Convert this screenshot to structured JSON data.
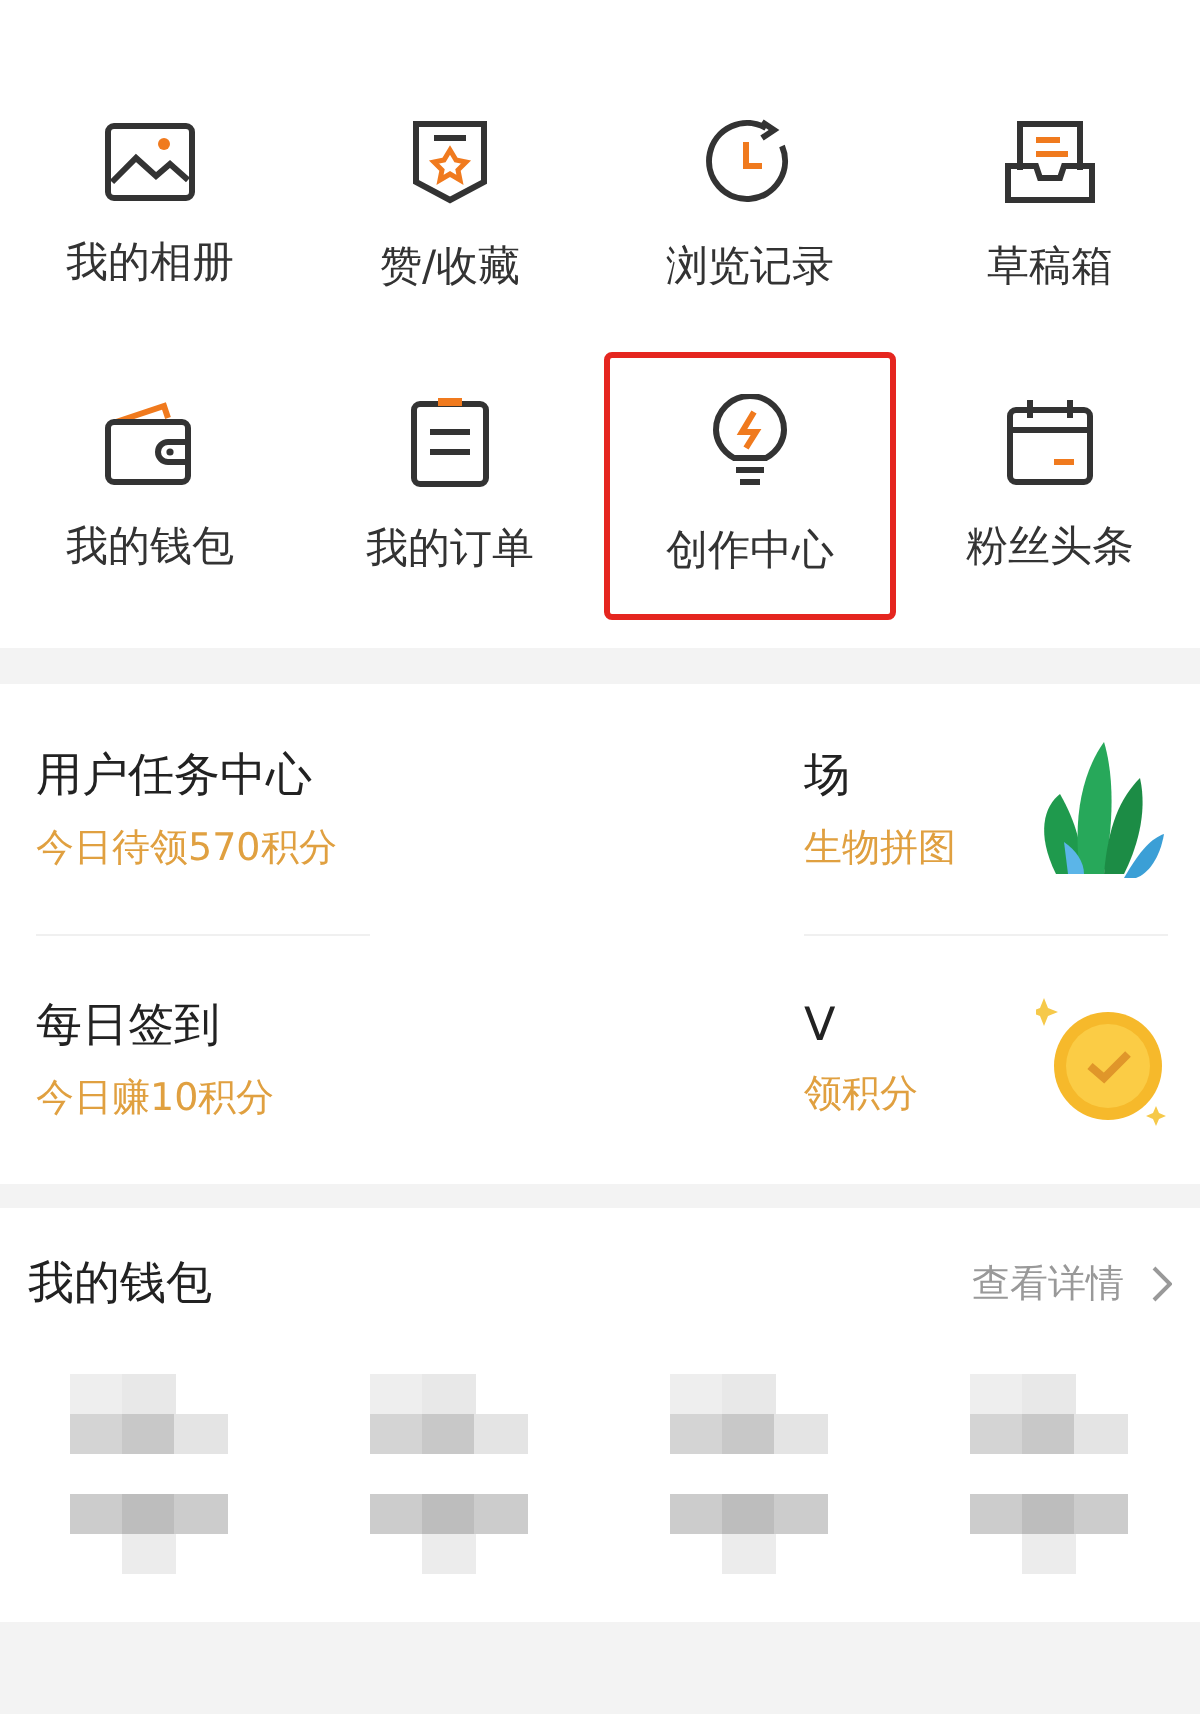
{
  "shortcuts": [
    {
      "label": "我的相册",
      "highlighted": false
    },
    {
      "label": "赞/收藏",
      "highlighted": false
    },
    {
      "label": "浏览记录",
      "highlighted": false
    },
    {
      "label": "草稿箱",
      "highlighted": false
    },
    {
      "label": "我的钱包",
      "highlighted": false
    },
    {
      "label": "我的订单",
      "highlighted": false
    },
    {
      "label": "创作中心",
      "highlighted": true
    },
    {
      "label": "粉丝头条",
      "highlighted": false
    }
  ],
  "tasks_left": [
    {
      "title": "用户任务中心",
      "subtitle": "今日待领570积分"
    },
    {
      "title": "每日签到",
      "subtitle": "今日赚10积分"
    }
  ],
  "tasks_right": [
    {
      "title": "场",
      "subtitle": "生物拼图"
    },
    {
      "title": "V",
      "subtitle": "领积分"
    }
  ],
  "wallet": {
    "title": "我的钱包",
    "link": "查看详情"
  }
}
